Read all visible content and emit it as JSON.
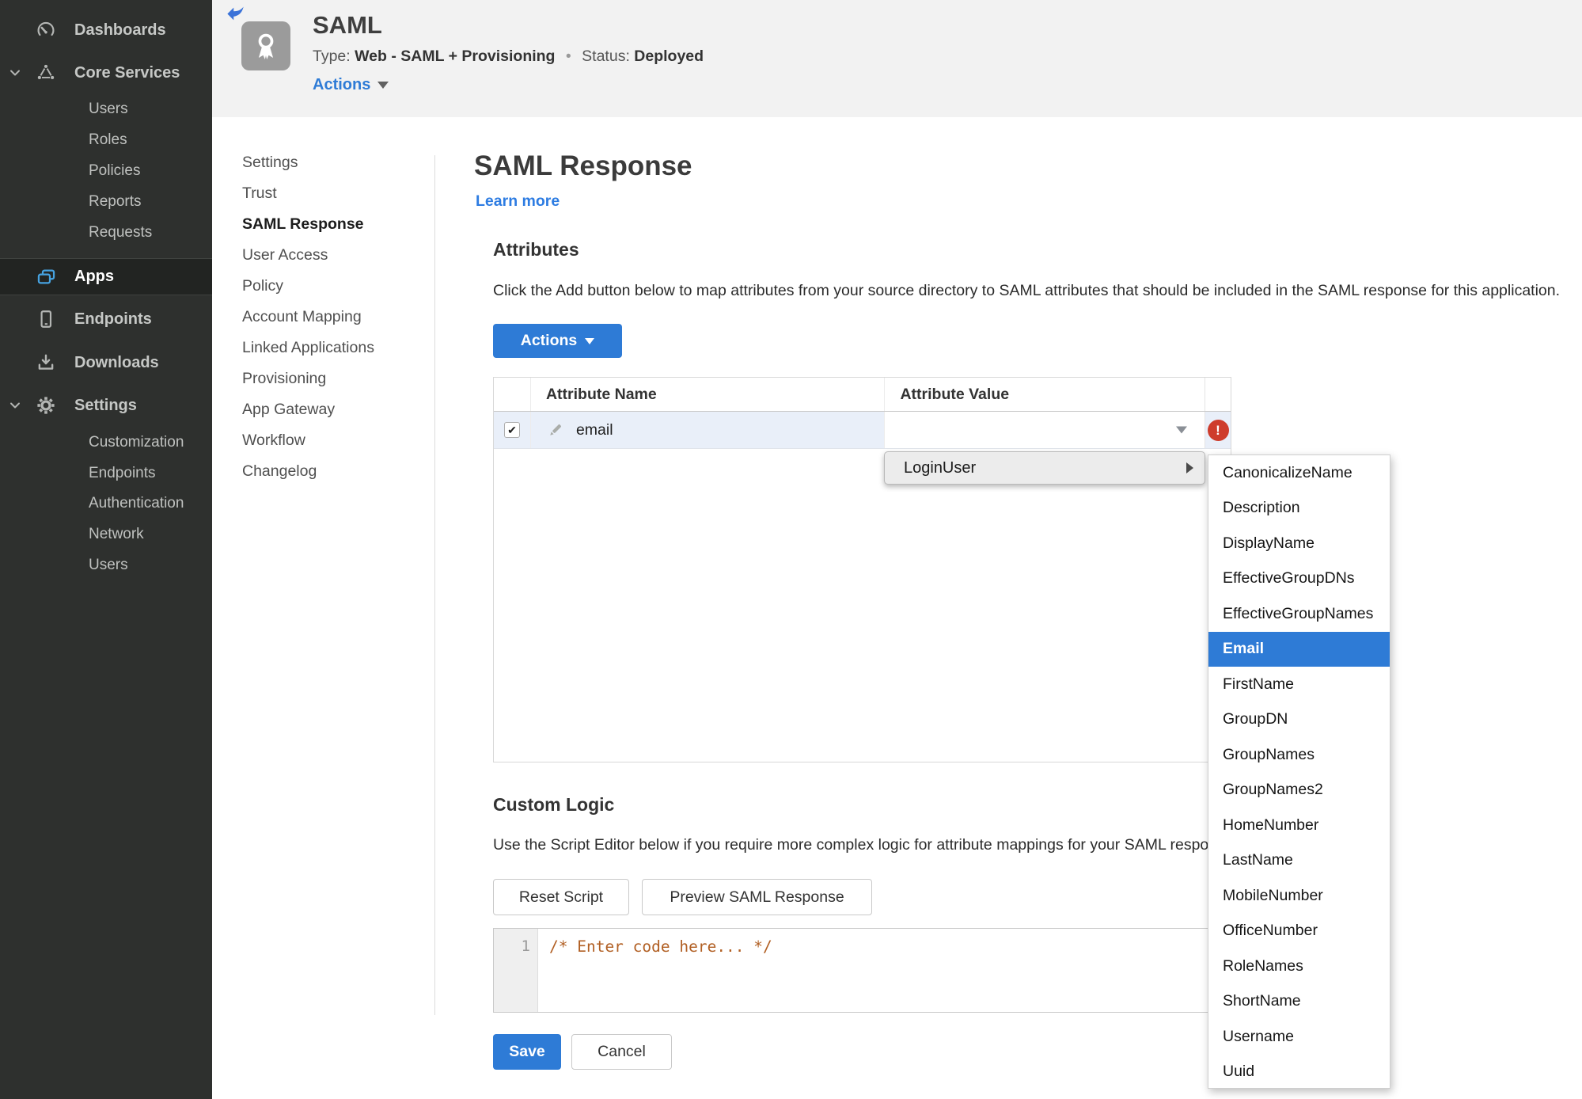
{
  "sidebar": {
    "dashboards": "Dashboards",
    "core_services": "Core Services",
    "core_sub": [
      "Users",
      "Roles",
      "Policies",
      "Reports",
      "Requests"
    ],
    "apps": "Apps",
    "endpoints": "Endpoints",
    "downloads": "Downloads",
    "settings": "Settings",
    "settings_sub": [
      "Customization",
      "Endpoints",
      "Authentication",
      "Network",
      "Users"
    ]
  },
  "header": {
    "title": "SAML",
    "type_label": "Type:",
    "type_value": "Web - SAML + Provisioning",
    "separator": "•",
    "status_label": "Status:",
    "status_value": "Deployed",
    "actions_label": "Actions"
  },
  "nav": {
    "items": [
      "Settings",
      "Trust",
      "SAML Response",
      "User Access",
      "Policy",
      "Account Mapping",
      "Linked Applications",
      "Provisioning",
      "App Gateway",
      "Workflow",
      "Changelog"
    ],
    "active": "SAML Response"
  },
  "main": {
    "title": "SAML Response",
    "learn_more": "Learn more",
    "attributes": {
      "heading": "Attributes",
      "description": "Click the Add button below to map attributes from your source directory to SAML attributes that should be included in the SAML response for this application.",
      "actions_button": "Actions",
      "table": {
        "columns": [
          "Attribute Name",
          "Attribute Value"
        ],
        "rows": [
          {
            "name": "email",
            "value": ""
          }
        ]
      }
    },
    "value_menu": {
      "item": "LoginUser",
      "selected": "Email",
      "submenu": [
        "CanonicalizeName",
        "Description",
        "DisplayName",
        "EffectiveGroupDNs",
        "EffectiveGroupNames",
        "Email",
        "FirstName",
        "GroupDN",
        "GroupNames",
        "GroupNames2",
        "HomeNumber",
        "LastName",
        "MobileNumber",
        "OfficeNumber",
        "RoleNames",
        "ShortName",
        "Username",
        "Uuid"
      ]
    },
    "custom_logic": {
      "heading": "Custom Logic",
      "description": "Use the Script Editor below if you require more complex logic for attribute mappings for your SAML response.",
      "reset_button": "Reset Script",
      "preview_button": "Preview SAML Response",
      "editor": {
        "line_number": "1",
        "code": "/* Enter code here... */"
      }
    },
    "save_button": "Save",
    "cancel_button": "Cancel"
  },
  "icons": {
    "checkmark_glyph": "✔",
    "error_glyph": "!"
  },
  "colors": {
    "accent_blue": "#2e7bd6",
    "status_green": "#3c8b1e",
    "error_red": "#ce3c2c",
    "sidebar_bg": "#2e302e",
    "sidebar_selected_bg": "#222422",
    "header_bg": "#f2f2f2",
    "row_highlight": "#e9eff9",
    "menu_gray": "#ececec",
    "code_comment": "#b15f23"
  }
}
